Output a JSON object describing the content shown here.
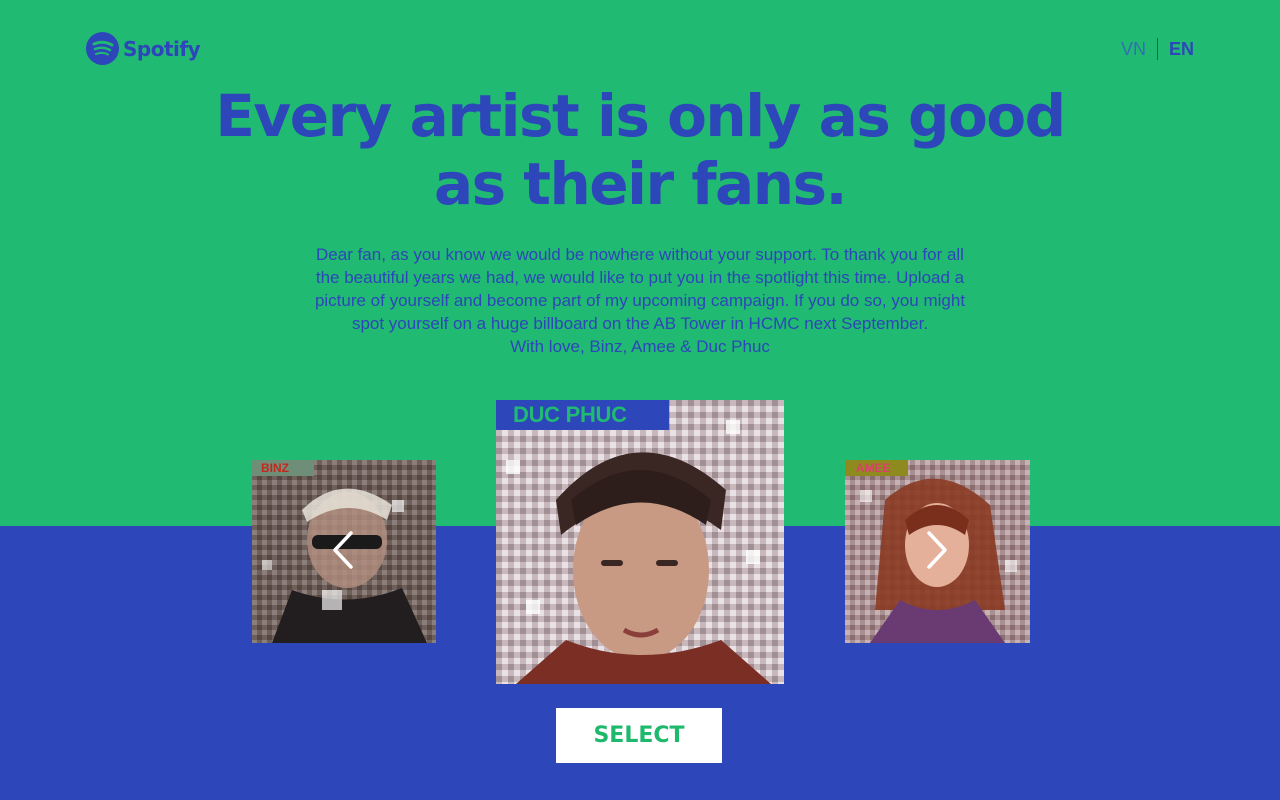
{
  "brand": {
    "name": "Spotify",
    "icon": "spotify-logo-icon"
  },
  "language": {
    "options": [
      "VN",
      "EN"
    ],
    "active": "EN"
  },
  "hero": {
    "headline_line1": "Every artist is only as good",
    "headline_line2": "as their fans.",
    "intro_line1": "Dear fan, as you know we would be nowhere without your support. To thank you for all",
    "intro_line2": "the beautiful years we had, we would like to put you in the spotlight this time. Upload a",
    "intro_line3": "picture of yourself and become part of my upcoming campaign. If you do so, you might",
    "intro_line4": "spot yourself on a huge billboard on the AB Tower in HCMC next September.",
    "intro_line5": "With love, Binz, Amee & Duc Phuc"
  },
  "artists": [
    {
      "label": "BINZ",
      "position": "left"
    },
    {
      "label": "DUC PHUC",
      "position": "center"
    },
    {
      "label": "AMEE",
      "position": "right"
    }
  ],
  "carousel": {
    "prev_icon": "chevron-left-icon",
    "next_icon": "chevron-right-icon"
  },
  "actions": {
    "select_label": "SELECT"
  },
  "colors": {
    "green": "#20ba72",
    "blue": "#2d46b9",
    "white": "#ffffff"
  }
}
